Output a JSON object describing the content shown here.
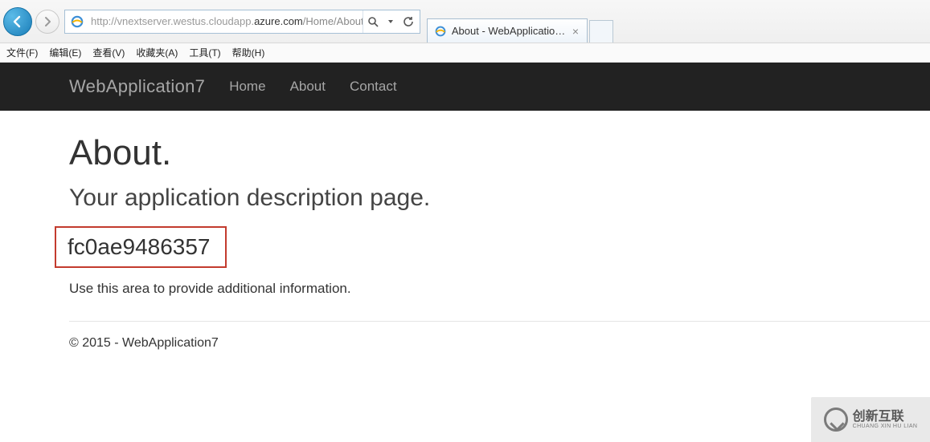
{
  "ie": {
    "url_host1": "http://vnextserver.westus.cloudapp.",
    "url_hostmain": "azure.com",
    "url_path": "/Home/About",
    "tab_title": "About - WebApplication7",
    "menubar": {
      "file": "文件(F)",
      "edit": "编辑(E)",
      "view": "查看(V)",
      "favorites": "收藏夹(A)",
      "tools": "工具(T)",
      "help": "帮助(H)"
    }
  },
  "page": {
    "brand": "WebApplication7",
    "nav": {
      "home": "Home",
      "about": "About",
      "contact": "Contact"
    },
    "heading": "About.",
    "subheading": "Your application description page.",
    "container_id": "fc0ae9486357",
    "description": "Use this area to provide additional information.",
    "footer": "© 2015 - WebApplication7"
  },
  "watermark": {
    "line1": "创新互联",
    "line2": "CHUANG XIN HU LIAN"
  }
}
